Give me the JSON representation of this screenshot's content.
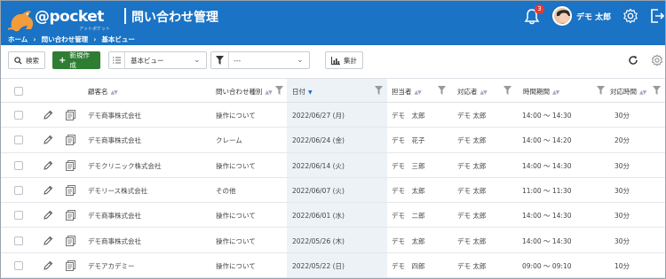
{
  "header": {
    "logo_text": "@pocket",
    "logo_sub": "アットポケット",
    "title": "問い合わせ管理",
    "notification_count": "3",
    "user_name": "デモ 太郎"
  },
  "breadcrumb": [
    "ホーム",
    "問い合わせ管理",
    "基本ビュー"
  ],
  "toolbar": {
    "search_label": "検索",
    "new_label": "新規作成",
    "view_value": "基本ビュー",
    "filter_value": "---",
    "aggregate_label": "集計"
  },
  "columns": [
    "顧客名",
    "問い合わせ種別",
    "日付",
    "担当者",
    "対応者",
    "時間期間",
    "対応時間"
  ],
  "rows": [
    {
      "customer": "デモ商事株式会社",
      "type": "操作について",
      "date": "2022/06/27 (月)",
      "assignee": "デモ　太郎",
      "responder": "デモ 太郎",
      "period": "14:00 ～ 14:30",
      "duration": "30分"
    },
    {
      "customer": "デモ商事株式会社",
      "type": "クレーム",
      "date": "2022/06/24 (金)",
      "assignee": "デモ　花子",
      "responder": "デモ 太郎",
      "period": "14:00 ～ 14:20",
      "duration": "20分"
    },
    {
      "customer": "デモクリニック株式会社",
      "type": "操作について",
      "date": "2022/06/14 (火)",
      "assignee": "デモ　三郎",
      "responder": "デモ 太郎",
      "period": "14:00 ～ 14:30",
      "duration": "30分"
    },
    {
      "customer": "デモリース株式会社",
      "type": "その他",
      "date": "2022/06/07 (火)",
      "assignee": "デモ　太郎",
      "responder": "デモ 太郎",
      "period": "11:00 ～ 11:30",
      "duration": "30分"
    },
    {
      "customer": "デモ商事株式会社",
      "type": "操作について",
      "date": "2022/06/01 (水)",
      "assignee": "デモ　二郎",
      "responder": "デモ 太郎",
      "period": "14:00 ～ 14:30",
      "duration": "30分"
    },
    {
      "customer": "デモ商事株式会社",
      "type": "操作について",
      "date": "2022/05/26 (木)",
      "assignee": "デモ　太郎",
      "responder": "デモ 太郎",
      "period": "14:00 ～ 14:30",
      "duration": "30分"
    },
    {
      "customer": "デモアカデミー",
      "type": "操作について",
      "date": "2022/05/22 (日)",
      "assignee": "デモ　四郎",
      "responder": "デモ 太郎",
      "period": "09:00 ～ 09:10",
      "duration": "10分"
    }
  ],
  "colors": {
    "header_bg": "#1a73c4",
    "new_button": "#2e7d32",
    "badge": "#e53935",
    "date_column": "#edf2f7"
  }
}
